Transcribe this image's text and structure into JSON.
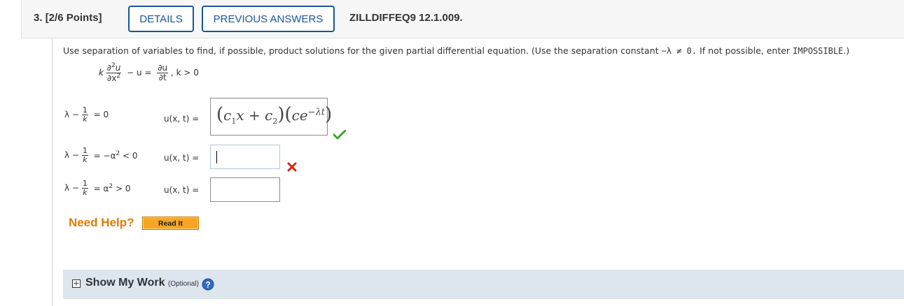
{
  "header": {
    "question_number": "3.",
    "points": "[2/6 Points]",
    "details_label": "DETAILS",
    "previous_answers_label": "PREVIOUS ANSWERS",
    "question_id": "ZILLDIFFEQ9 12.1.009."
  },
  "instructions": {
    "text": "Use separation of variables to find, if possible, product solutions for the given partial differential equation. (Use the separation constant ",
    "constant_expr": "−λ ≠ 0.",
    "text2": " If not possible, enter ",
    "impossible": "IMPOSSIBLE",
    "text3": ".)"
  },
  "equation": {
    "k": "k",
    "num_left": "∂",
    "num_left_sup": "2",
    "num_left_var": "u",
    "den_left": "∂x",
    "den_left_sup": "2",
    "minus_u": "− u =",
    "num_right": "∂u",
    "den_right": "∂t",
    "condition": ", k > 0"
  },
  "cases": [
    {
      "lambda": "λ −",
      "frac_num": "1",
      "frac_den": "k",
      "rhs": "= 0",
      "u_label": "u(x, t) =",
      "answer_latex": "(c1x + c2)(ce−λt)",
      "status": "correct"
    },
    {
      "lambda": "λ −",
      "frac_num": "1",
      "frac_den": "k",
      "rhs_prefix": "= −α",
      "rhs_sup": "2",
      "rhs_suffix": " < 0",
      "u_label": "u(x, t) =",
      "answer": "",
      "status": "incorrect"
    },
    {
      "lambda": "λ −",
      "frac_num": "1",
      "frac_den": "k",
      "rhs_prefix": "= α",
      "rhs_sup": "2",
      "rhs_suffix": " > 0",
      "u_label": "u(x, t) =",
      "answer": ""
    }
  ],
  "answer1": {
    "open1": "(",
    "c1": "c",
    "sub1": "1",
    "x": "x + c",
    "sub2": "2",
    "close1": ")",
    "open2": "(",
    "ce": "ce",
    "exp": "−λt",
    "close2": ")"
  },
  "help": {
    "need_help": "Need Help?",
    "read_it": "Read It"
  },
  "show_my_work": {
    "toggle": "+",
    "label": "Show My Work",
    "optional": "(Optional)"
  },
  "colors": {
    "accent_blue": "#1a5699",
    "check_green": "#3f9e2f",
    "x_red": "#e0221b",
    "help_orange": "#e07b00",
    "readit_bg": "#f6a623",
    "smw_bg": "#dde5ef"
  }
}
